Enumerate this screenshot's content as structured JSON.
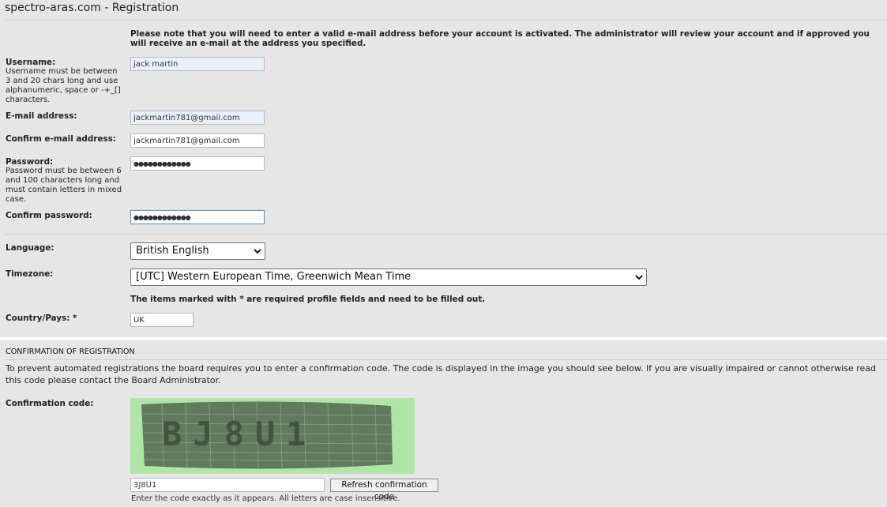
{
  "page": {
    "title": "spectro-aras.com - Registration"
  },
  "notice": "Please note that you will need to enter a valid e-mail address before your account is activated. The administrator will review your account and if approved you will receive an e-mail at the address you specified.",
  "form": {
    "username": {
      "label": "Username:",
      "hint": "Username must be between 3 and 20 chars long and use alphanumeric, space or -+_[] characters.",
      "value": "jack martin"
    },
    "email": {
      "label": "E-mail address:",
      "value": "jackmartin781@gmail.com"
    },
    "confirm_email": {
      "label": "Confirm e-mail address:",
      "value": "jackmartin781@gmail.com"
    },
    "password": {
      "label": "Password:",
      "hint": "Password must be between 6 and 100 characters long and must contain letters in mixed case.",
      "value": "●●●●●●●●●●●●"
    },
    "confirm_password": {
      "label": "Confirm password:",
      "value": "●●●●●●●●●●●●"
    },
    "language": {
      "label": "Language:",
      "selected": "British English"
    },
    "timezone": {
      "label": "Timezone:",
      "selected": "[UTC] Western European Time, Greenwich Mean Time"
    },
    "required_note": "The items marked with * are required profile fields and need to be filled out.",
    "country": {
      "label": "Country/Pays: *",
      "value": "UK"
    }
  },
  "confirmation": {
    "section_title": "CONFIRMATION OF REGISTRATION",
    "text_before": "To prevent automated registrations the board requires you to enter a confirmation code. The code is displayed in the image you should see below. If you are visually impaired or cannot otherwise read this code please contact the ",
    "link": "Board Administrator",
    "text_after": ".",
    "code_label": "Confirmation code:",
    "code_value": "3J8U1",
    "captcha_text": "BJ8U1",
    "refresh_button": "Refresh confirmation code",
    "footer_note": "Enter the code exactly as it appears. All letters are case insensitive."
  },
  "colors": {
    "captcha_bg": "#b1e5a8",
    "captcha_mesh": "#5e7a5a",
    "autofill": "#e8f0fe"
  }
}
